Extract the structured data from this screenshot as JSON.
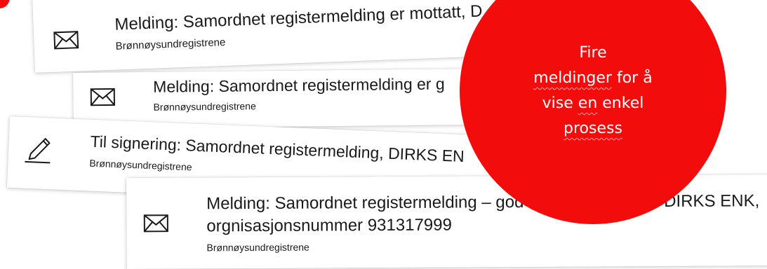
{
  "colors": {
    "bubble": "#f20c0c",
    "bubble_text": "#ffffff",
    "card_text": "#1a1a1a"
  },
  "cards": [
    {
      "icon": "envelope-icon",
      "title": "Melding: Samordnet registermelding er mottatt, D",
      "sender": "Brønnøysundregistrene"
    },
    {
      "icon": "envelope-icon",
      "title": "Melding: Samordnet registermelding er g",
      "sender": "Brønnøysundregistrene"
    },
    {
      "icon": "pen-signature-icon",
      "title": "Til signering: Samordnet registermelding, DIRKS EN",
      "sender": "Brønnøysundregistrene"
    },
    {
      "icon": "envelope-icon",
      "title_line1": "Melding: Samordnet registermelding – god",
      "title_line1_end": "DIRKS ENK,",
      "title_line2": "orgnisasjonsnummer 931317999",
      "sender": "Brønnøysundregistrene"
    }
  ],
  "callout": {
    "line1": "Fire",
    "line2_word": "meldinger",
    "line2_rest": "for å",
    "line3_start": "vise",
    "line3_word": "en",
    "line3_end": "enkel",
    "line4_word": "prosess"
  }
}
